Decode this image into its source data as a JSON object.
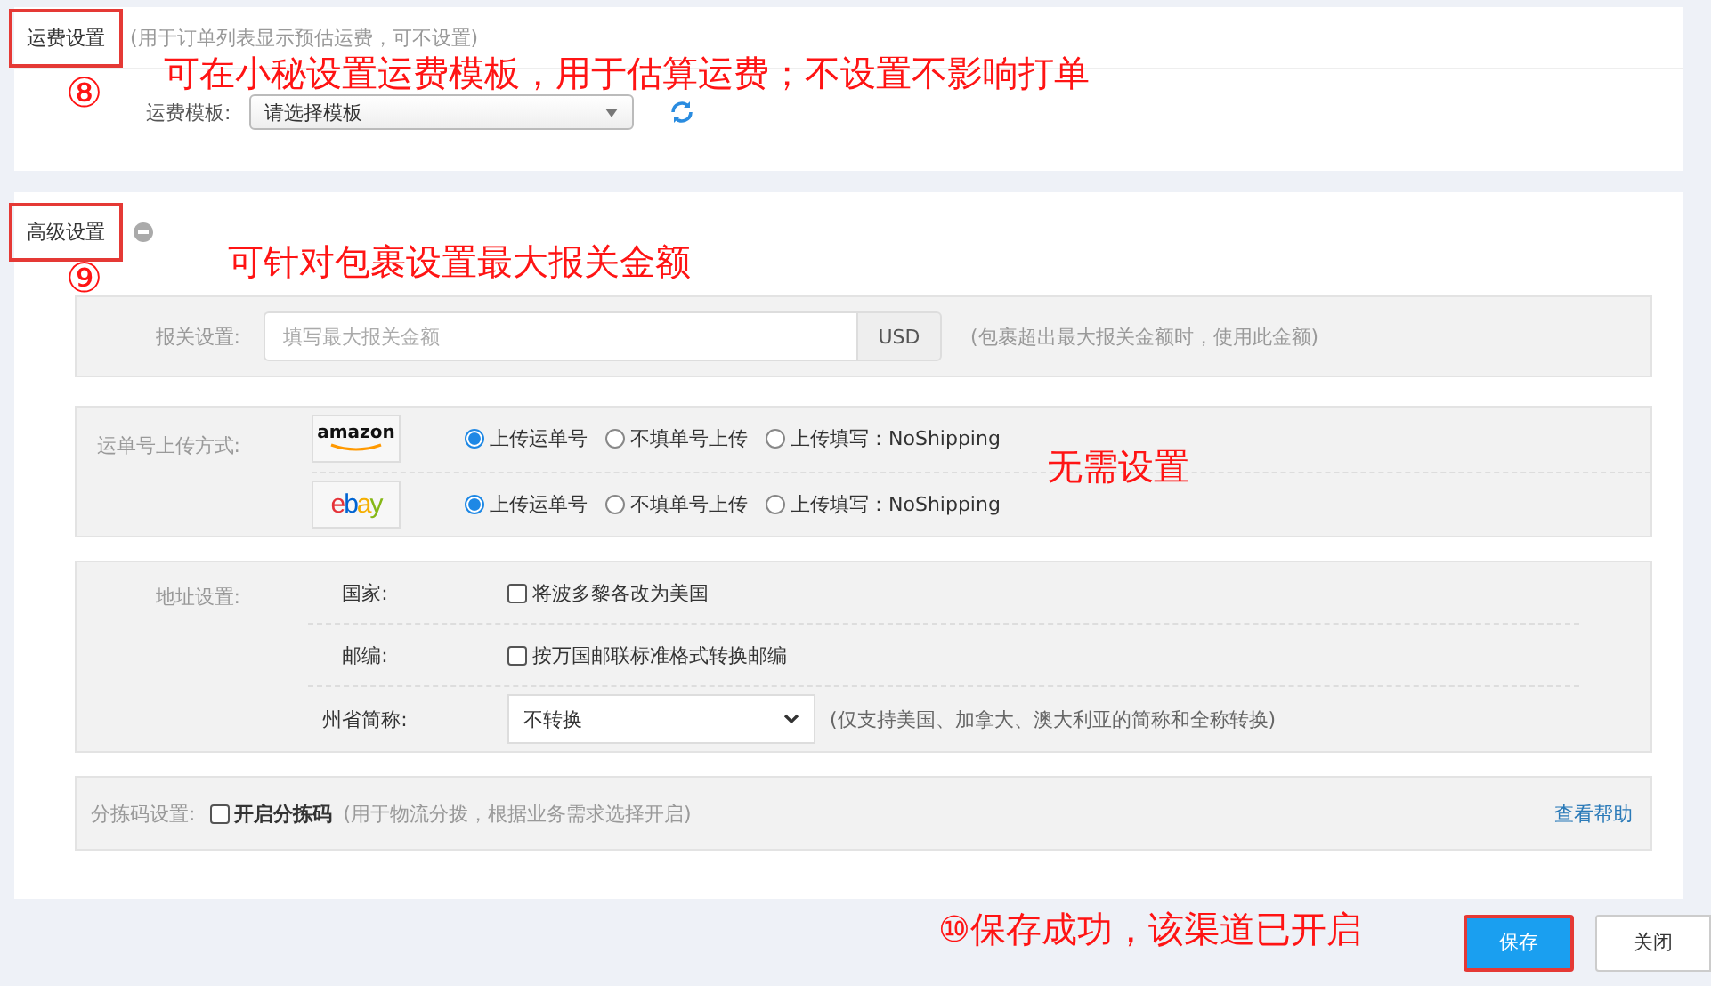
{
  "freight": {
    "title": "运费设置",
    "highlighted": true,
    "hint": "(用于订单列表显示预估运费，可不设置)",
    "template_label": "运费模板:",
    "template_placeholder": "请选择模板"
  },
  "advanced": {
    "title": "高级设置",
    "highlighted": true,
    "customs": {
      "label": "报关设置:",
      "placeholder": "填写最大报关金额",
      "unit": "USD",
      "hint": "(包裹超出最大报关金额时，使用此金额)"
    },
    "upload": {
      "label": "运单号上传方式:",
      "platforms": [
        {
          "kind": "amazon",
          "logo": "amazon",
          "options": [
            {
              "label": "上传运单号",
              "selected": true
            },
            {
              "label": "不填单号上传",
              "selected": false
            },
            {
              "label": "上传填写：NoShipping",
              "selected": false
            }
          ]
        },
        {
          "kind": "ebay",
          "logo": "ebay",
          "options": [
            {
              "label": "上传运单号",
              "selected": true
            },
            {
              "label": "不填单号上传",
              "selected": false
            },
            {
              "label": "上传填写：NoShipping",
              "selected": false
            }
          ]
        }
      ]
    },
    "address": {
      "label": "地址设置:",
      "rows": [
        {
          "kind": "checkbox",
          "label": "国家:",
          "option": "将波多黎各改为美国",
          "checked": false
        },
        {
          "kind": "checkbox",
          "label": "邮编:",
          "option": "按万国邮联标准格式转换邮编",
          "checked": false
        },
        {
          "kind": "select",
          "label": "州省简称:",
          "value": "不转换",
          "hint": "(仅支持美国、加拿大、澳大利亚的简称和全称转换)"
        }
      ]
    },
    "sorting": {
      "label": "分拣码设置:",
      "option": "开启分拣码",
      "checked": false,
      "hint": "(用于物流分拨，根据业务需求选择开启)",
      "help_link": "查看帮助"
    }
  },
  "buttons": [
    {
      "label": "保存",
      "kind": "primary",
      "highlighted": true
    },
    {
      "label": "关闭",
      "kind": "default",
      "highlighted": false
    }
  ],
  "annotations": [
    {
      "kind": "note",
      "text": "可在小秘设置运费模板，用于估算运费；不设置不影响打单"
    },
    {
      "kind": "marker",
      "text": "⑧"
    },
    {
      "kind": "note",
      "text": "可针对包裹设置最大报关金额"
    },
    {
      "kind": "marker",
      "text": "⑨"
    },
    {
      "kind": "note",
      "text": "无需设置"
    },
    {
      "kind": "note",
      "text": "⑩保存成功，该渠道已开启"
    }
  ]
}
